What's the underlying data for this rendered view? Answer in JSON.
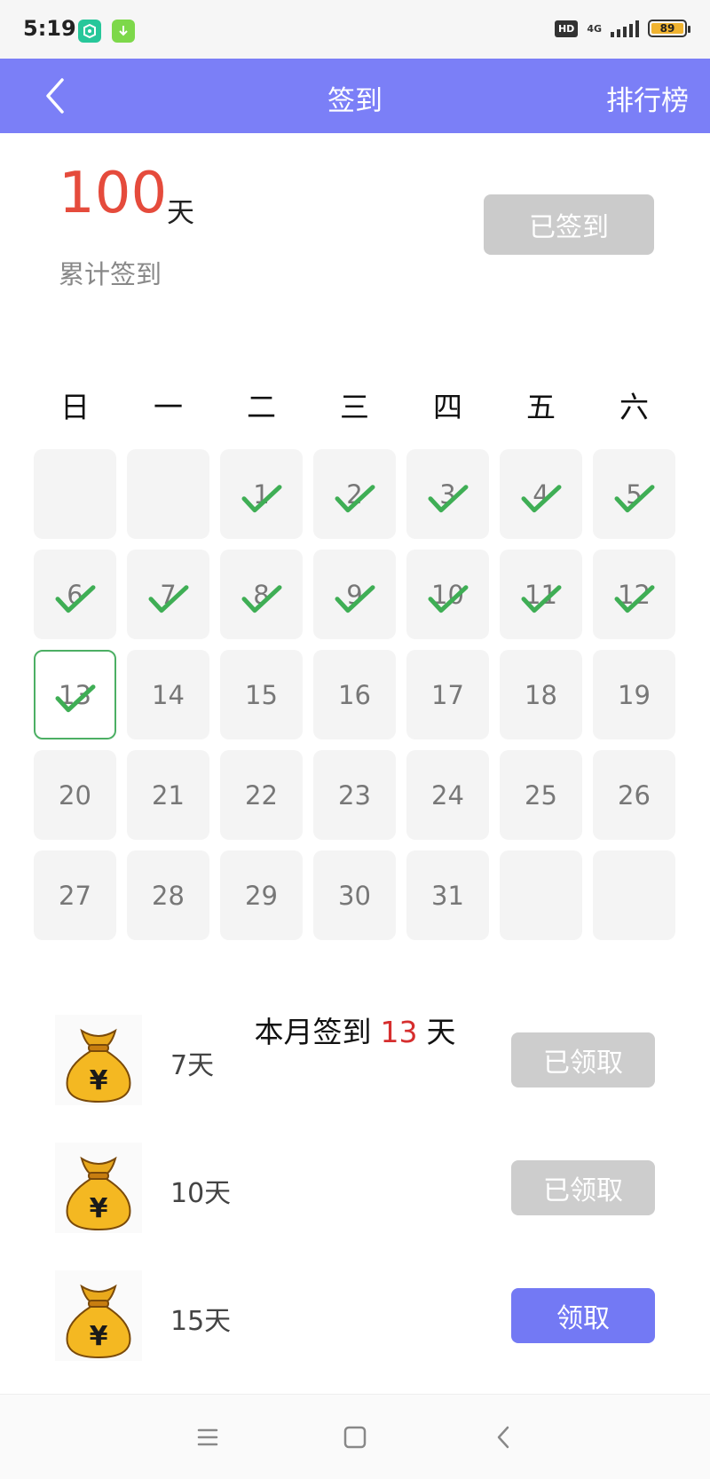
{
  "status_bar": {
    "time": "5:19",
    "hd": "HD",
    "network": "4G",
    "battery": "89"
  },
  "header": {
    "title": "签到",
    "right_link": "排行榜"
  },
  "summary": {
    "total_days": "100",
    "unit": "天",
    "label": "累计签到",
    "button": "已签到"
  },
  "calendar": {
    "weekdays": [
      "日",
      "一",
      "二",
      "三",
      "四",
      "五",
      "六"
    ],
    "cells": [
      "",
      "",
      "1",
      "2",
      "3",
      "4",
      "5",
      "6",
      "7",
      "8",
      "9",
      "10",
      "11",
      "12",
      "13",
      "14",
      "15",
      "16",
      "17",
      "18",
      "19",
      "20",
      "21",
      "22",
      "23",
      "24",
      "25",
      "26",
      "27",
      "28",
      "29",
      "30",
      "31",
      "",
      ""
    ],
    "checked_days": [
      1,
      2,
      3,
      4,
      5,
      6,
      7,
      8,
      9,
      10,
      11,
      12,
      13
    ],
    "today": 13,
    "check_color": "#3fae55"
  },
  "month_summary": {
    "prefix": "本月签到",
    "count": "13",
    "suffix": "天"
  },
  "rewards": [
    {
      "label": "7天",
      "button": "已领取",
      "status": "claimed"
    },
    {
      "label": "10天",
      "button": "已领取",
      "status": "claimed"
    },
    {
      "label": "15天",
      "button": "领取",
      "status": "available"
    }
  ],
  "colors": {
    "accent": "#7b7ff7",
    "highlight": "#e54b3c"
  }
}
